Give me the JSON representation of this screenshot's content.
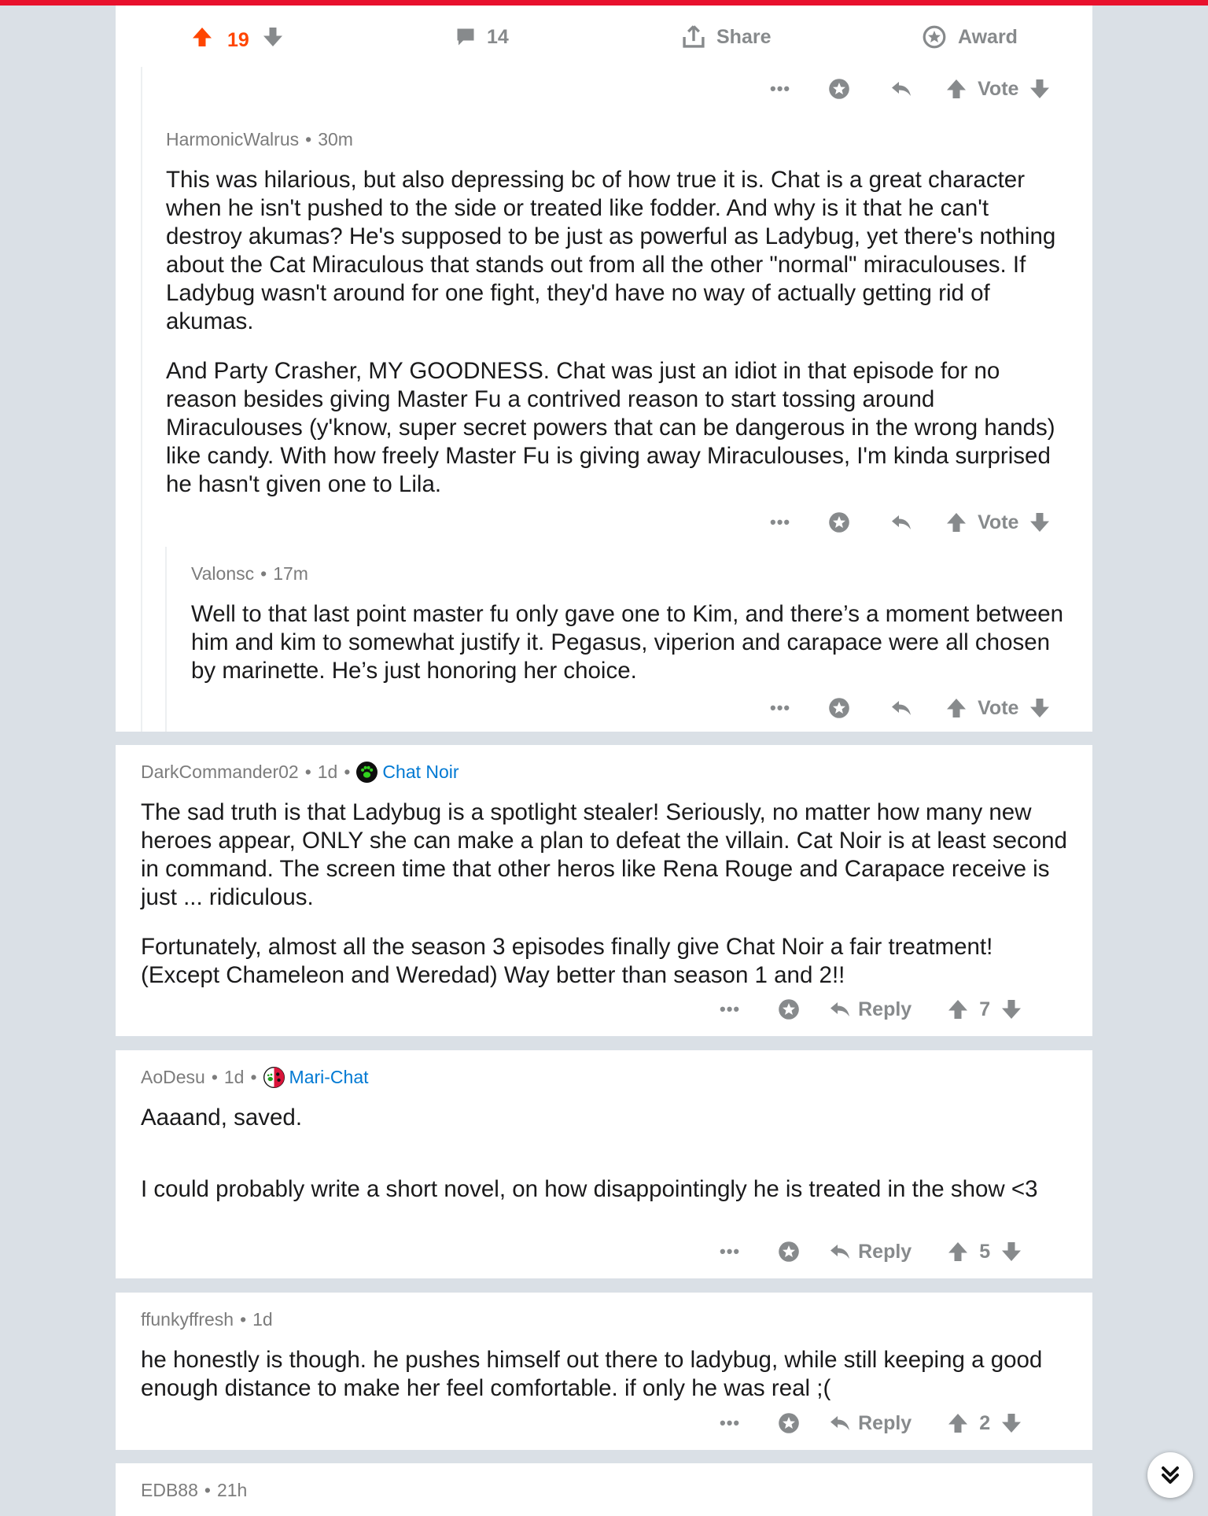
{
  "post_bar": {
    "upvotes": "19",
    "comments": "14",
    "share_label": "Share",
    "award_label": "Award"
  },
  "labels": {
    "vote": "Vote",
    "reply": "Reply",
    "more": "•••",
    "sep": "•"
  },
  "comments": [
    {
      "author": "HarmonicWalrus",
      "age": "30m",
      "paragraphs": [
        "This was hilarious, but also depressing bc of how true it is. Chat is a great character when he isn't pushed to the side or treated like fodder. And why is it that he can't destroy akumas? He's supposed to be just as powerful as Ladybug, yet there's nothing about the Cat Miraculous that stands out from all the other \"normal\" miraculouses. If Ladybug wasn't around for one fight, they'd have no way of actually getting rid of akumas.",
        "And Party Crasher, MY GOODNESS. Chat was just an idiot in that episode for no reason besides giving Master Fu a contrived reason to start tossing around Miraculouses (y'know, super secret powers that can be dangerous in the wrong hands) like candy. With how freely Master Fu is giving away Miraculouses, I'm kinda surprised he hasn't given one to Lila."
      ]
    },
    {
      "author": "Valonsc",
      "age": "17m",
      "paragraphs": [
        "Well to that last point master fu only gave one to Kim, and there’s a moment between him and kim to somewhat justify it. Pegasus, viperion and carapace were all chosen by marinette. He’s just honoring her choice."
      ]
    },
    {
      "author": "DarkCommander02",
      "age": "1d",
      "flair": "Chat Noir",
      "score": "7",
      "paragraphs": [
        "The sad truth is that Ladybug is a spotlight stealer! Seriously, no matter how many new heroes appear, ONLY she can make a plan to defeat the villain. Cat Noir is at least second in command. The screen time that other heros like Rena Rouge and Carapace receive is just ... ridiculous.",
        "Fortunately, almost all the season 3 episodes finally give Chat Noir a fair treatment! (Except Chameleon and Weredad) Way better than season 1 and 2!!"
      ]
    },
    {
      "author": "AoDesu",
      "age": "1d",
      "flair": "Mari-Chat",
      "score": "5",
      "paragraphs": [
        "Aaaand, saved.",
        "I could  probably write a short novel, on how disappointingly he is treated in the show <3"
      ]
    },
    {
      "author": "ffunkyffresh",
      "age": "1d",
      "score": "2",
      "paragraphs": [
        "he honestly is though. he pushes himself out there to ladybug, while still keeping a good enough distance to make her feel comfortable. if only he was real ;("
      ]
    },
    {
      "author": "EDB88",
      "age": "21h"
    }
  ],
  "colors": {
    "upvote_active": "#ff4500",
    "flair_link": "#0079d3",
    "icon_gray": "#878a8c",
    "top_bar": "#e8112d"
  },
  "icons": [
    "upvote-icon",
    "downvote-icon",
    "comment-icon",
    "share-icon",
    "award-icon",
    "reply-icon",
    "scroll-down-icon"
  ]
}
